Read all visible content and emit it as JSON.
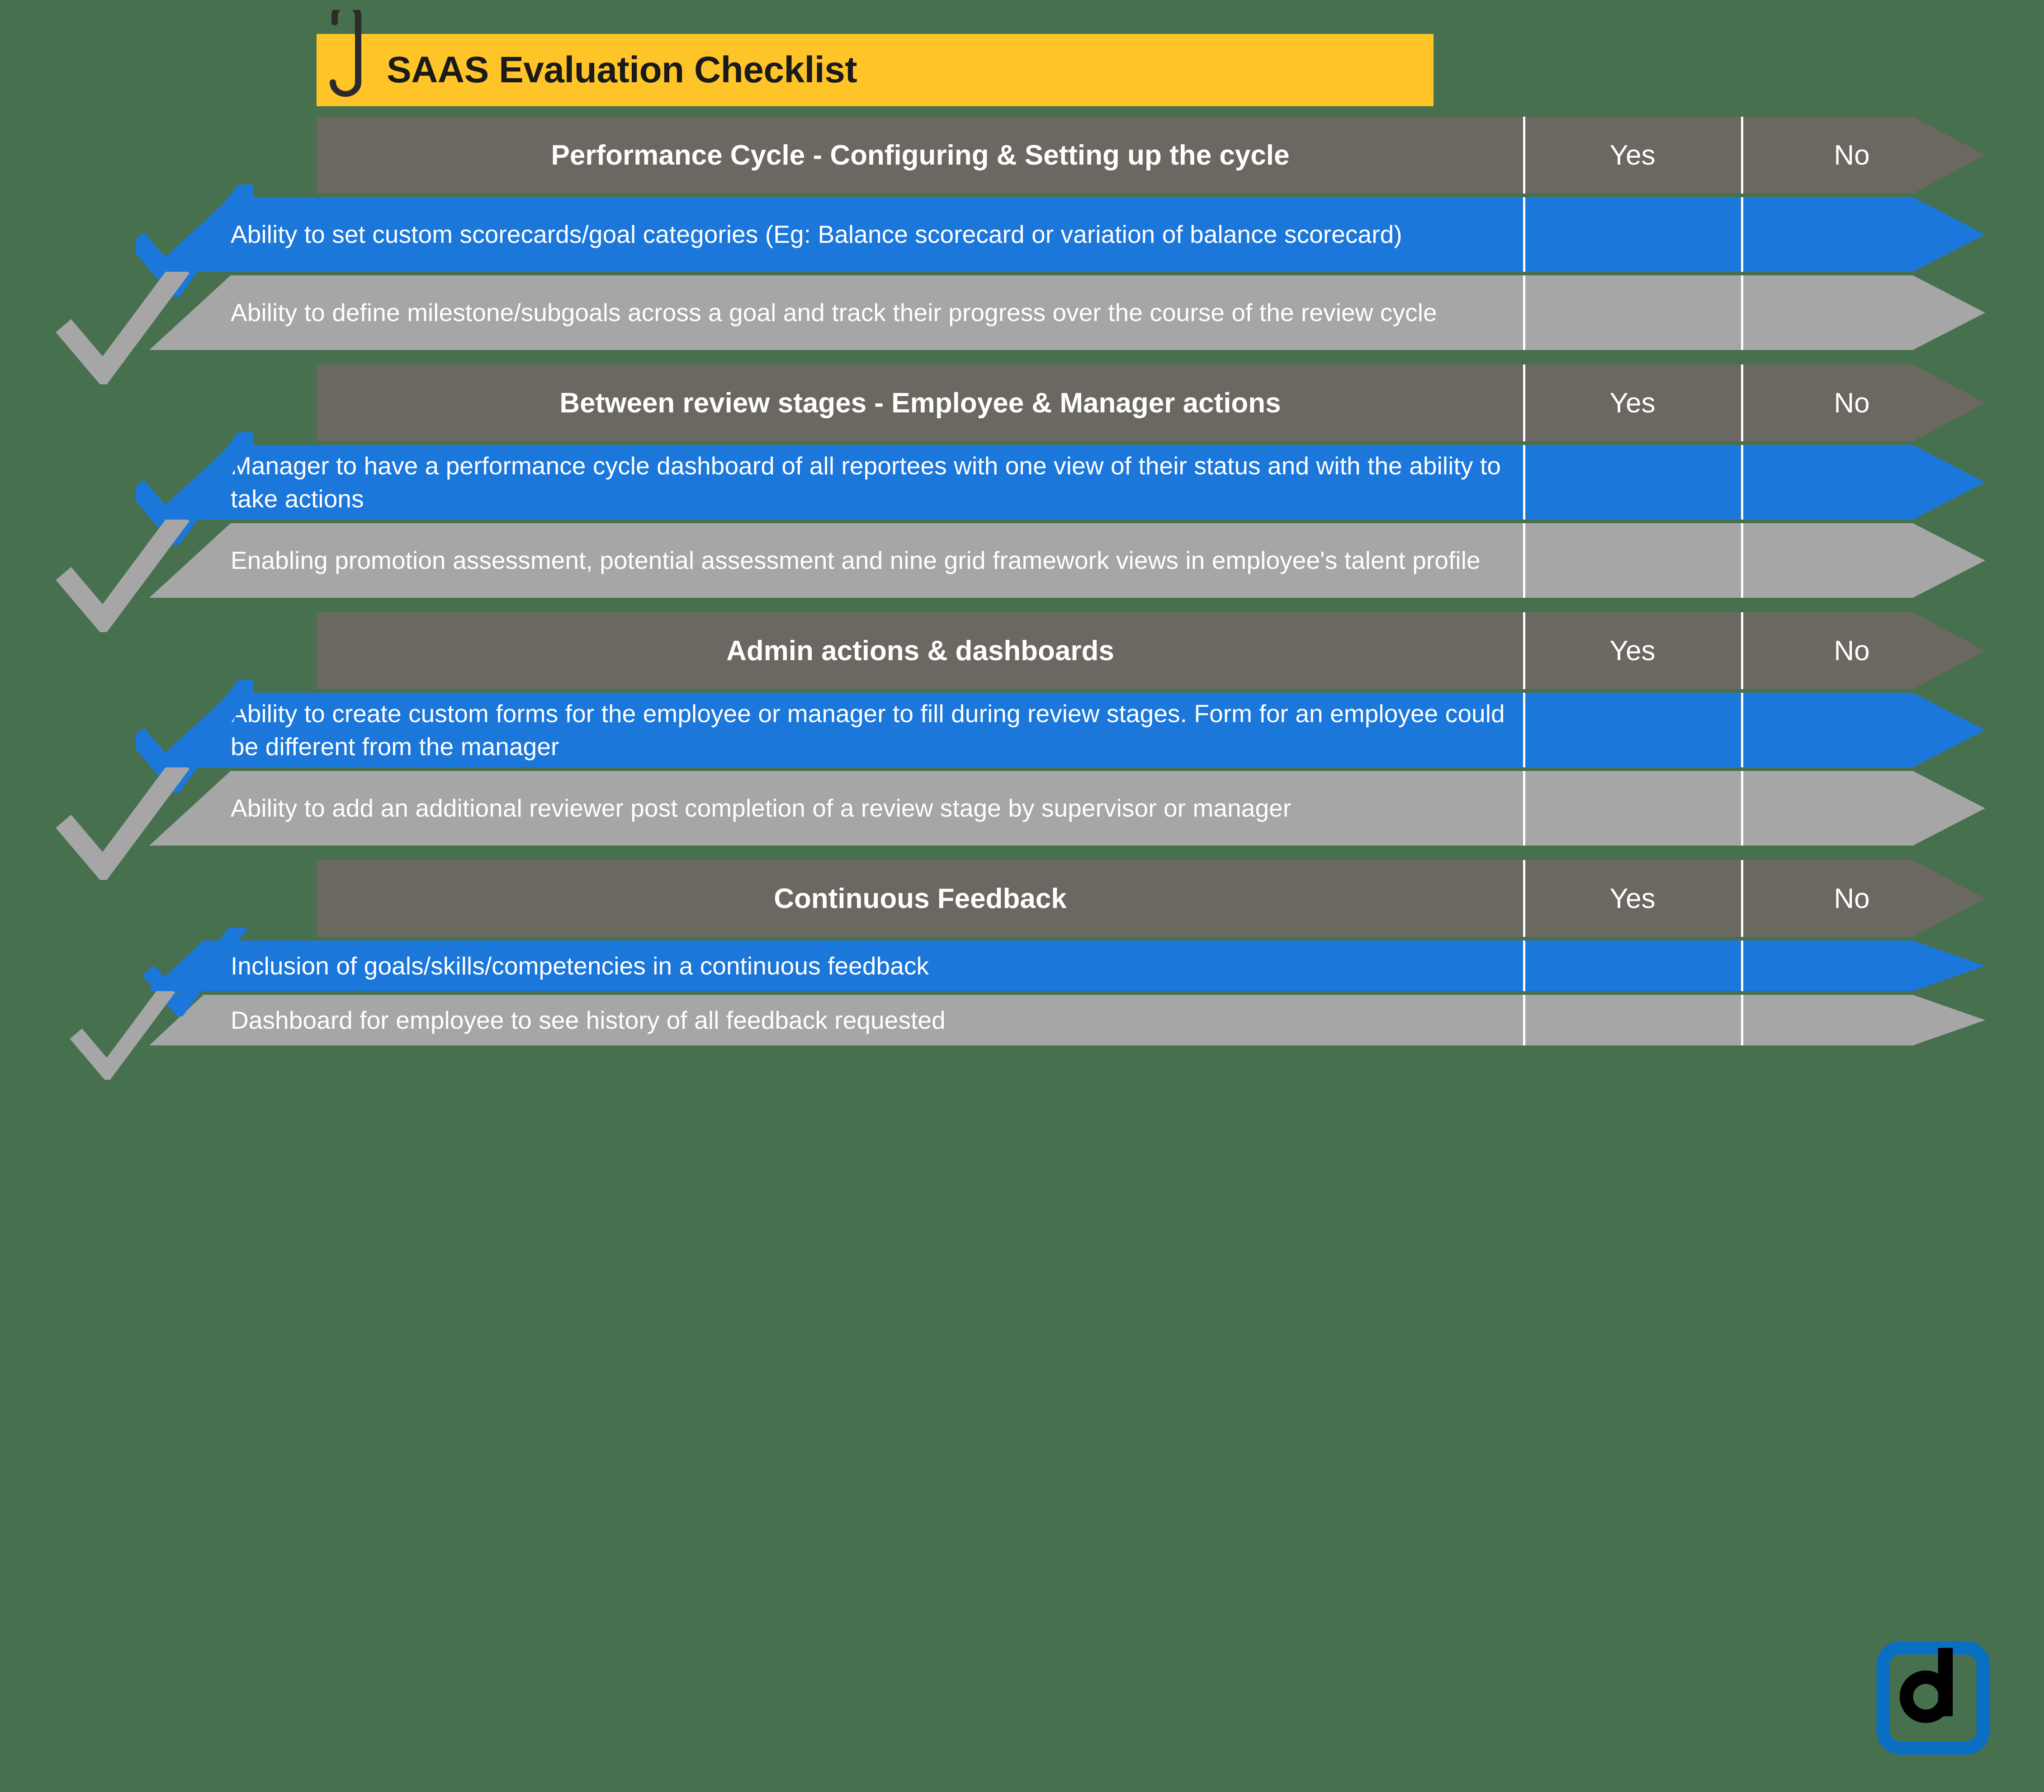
{
  "document": {
    "title": "SAAS Evaluation Checklist",
    "background_color": "#47704e",
    "accent_yellow": "#ffc528",
    "accent_blue": "#1c77db",
    "header_grey": "#6b6761",
    "row_grey": "#a6a6a6",
    "paperclip_icon": "paperclip-icon",
    "logo_letter": "d"
  },
  "columns": {
    "yes": "Yes",
    "no": "No"
  },
  "sections": [
    {
      "heading": "Performance Cycle -  Configuring & Setting up the cycle",
      "yes": "Yes",
      "no": "No",
      "items": [
        {
          "text": "Ability to set custom scorecards/goal categories (Eg: Balance scorecard or variation of balance scorecard)",
          "style": "blue",
          "lines": 2
        },
        {
          "text": "Ability to define milestone/subgoals across a goal and track their progress over the course of the review cycle",
          "style": "grey",
          "lines": 2
        }
      ]
    },
    {
      "heading": "Between review stages - Employee & Manager actions",
      "yes": "Yes",
      "no": "No",
      "items": [
        {
          "text": "Manager to have a performance cycle dashboard of all reportees with one view of their status and with the ability to take actions",
          "style": "blue",
          "lines": 2
        },
        {
          "text": "Enabling promotion assessment, potential assessment and nine grid framework views in employee's talent profile",
          "style": "grey",
          "lines": 2
        }
      ]
    },
    {
      "heading": "Admin actions & dashboards",
      "yes": "Yes",
      "no": "No",
      "items": [
        {
          "text": "Ability to create custom forms for the employee or manager to fill during review stages. Form for an employee could be different from the manager",
          "style": "blue",
          "lines": 2
        },
        {
          "text": "Ability to add an additional reviewer post completion of a review stage by supervisor or manager",
          "style": "grey",
          "lines": 2
        }
      ]
    },
    {
      "heading": "Continuous Feedback",
      "yes": "Yes",
      "no": "No",
      "items": [
        {
          "text": "Inclusion of goals/skills/competencies in a continuous feedback",
          "style": "blue",
          "lines": 1
        },
        {
          "text": "Dashboard for employee to see history of all feedback requested",
          "style": "grey",
          "lines": 1
        }
      ]
    }
  ]
}
